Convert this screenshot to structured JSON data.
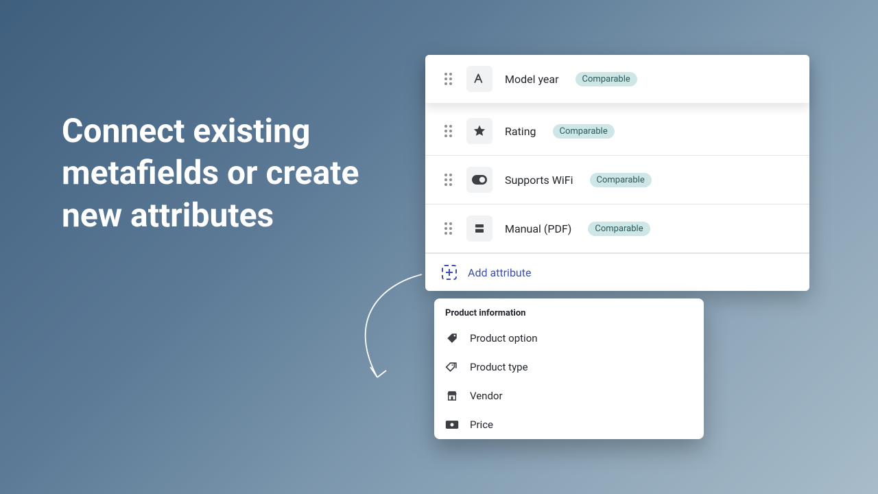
{
  "headline": "Connect existing metafields or create new attributes",
  "badge_label": "Comparable",
  "attributes": [
    {
      "name": "Model year",
      "icon": "text"
    },
    {
      "name": "Rating",
      "icon": "star"
    },
    {
      "name": "Supports WiFi",
      "icon": "toggle"
    },
    {
      "name": "Manual (PDF)",
      "icon": "file"
    }
  ],
  "add_attribute_label": "Add attribute",
  "popover": {
    "title": "Product information",
    "items": [
      {
        "name": "Product option",
        "icon": "tag"
      },
      {
        "name": "Product type",
        "icon": "tags"
      },
      {
        "name": "Vendor",
        "icon": "store"
      },
      {
        "name": "Price",
        "icon": "price"
      }
    ]
  }
}
